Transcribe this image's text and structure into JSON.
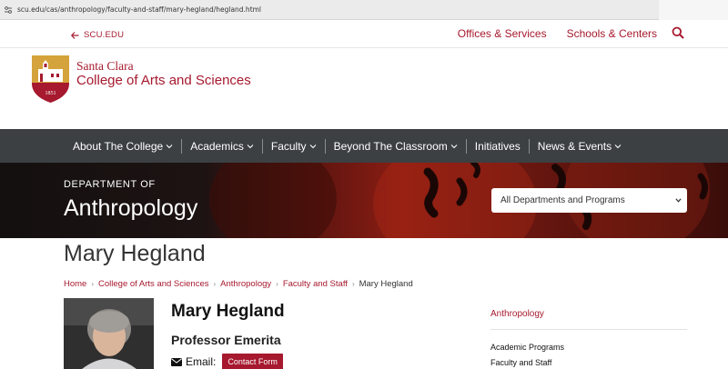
{
  "browser": {
    "url": "scu.edu/cas/anthropology/faculty-and-staff/mary-hegland/hegland.html"
  },
  "utility": {
    "back_label": "SCU.EDU",
    "offices_label": "Offices & Services",
    "schools_label": "Schools & Centers"
  },
  "logo": {
    "line1": "Santa Clara",
    "line2": "College of Arts and Sciences",
    "seal_year": "1851"
  },
  "nav": {
    "items": [
      {
        "label": "About The College"
      },
      {
        "label": "Academics"
      },
      {
        "label": "Faculty"
      },
      {
        "label": "Beyond The Classroom"
      },
      {
        "label": "Initiatives"
      },
      {
        "label": "News & Events"
      }
    ]
  },
  "hero": {
    "dept_prefix": "DEPARTMENT OF",
    "dept_name": "Anthropology",
    "select_value": "All Departments and Programs"
  },
  "page": {
    "title": "Mary Hegland"
  },
  "breadcrumb": {
    "items": [
      "Home",
      "College of Arts and Sciences",
      "Anthropology",
      "Faculty and Staff"
    ],
    "current": "Mary Hegland"
  },
  "profile": {
    "name": "Mary Hegland",
    "role": "Professor Emerita",
    "email_label": "Email:",
    "contact_button": "Contact Form"
  },
  "sidebar": {
    "top_link": "Anthropology",
    "items": [
      "Academic Programs",
      "Faculty and Staff"
    ]
  },
  "colors": {
    "brand": "#a6192e",
    "nav_bg": "#3c4043"
  },
  "icons": {
    "back": "arrow-left-icon",
    "search": "search-icon",
    "nav_chevron": "chevron-down-icon",
    "email": "envelope-icon"
  }
}
